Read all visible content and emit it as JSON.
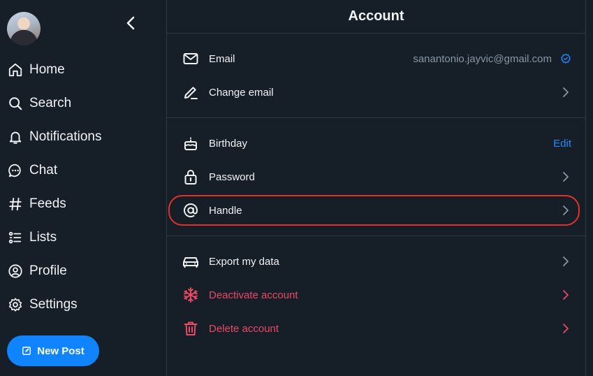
{
  "sidebar": {
    "nav": [
      {
        "label": "Home",
        "icon": "home-icon"
      },
      {
        "label": "Search",
        "icon": "search-icon"
      },
      {
        "label": "Notifications",
        "icon": "bell-icon"
      },
      {
        "label": "Chat",
        "icon": "chat-bubble-icon"
      },
      {
        "label": "Feeds",
        "icon": "hashtag-icon"
      },
      {
        "label": "Lists",
        "icon": "list-icon"
      },
      {
        "label": "Profile",
        "icon": "user-circle-icon"
      },
      {
        "label": "Settings",
        "icon": "gear-icon"
      }
    ],
    "new_post_label": "New Post"
  },
  "header": {
    "title": "Account"
  },
  "groups": [
    {
      "rows": [
        {
          "label": "Email",
          "value": "sanantonio.jayvic@gmail.com",
          "icon": "envelope-icon",
          "trailing": "verified-badge-icon"
        },
        {
          "label": "Change email",
          "icon": "pencil-icon",
          "trailing": "chevron-right-icon"
        }
      ]
    },
    {
      "rows": [
        {
          "label": "Birthday",
          "icon": "cake-icon",
          "action": "Edit"
        },
        {
          "label": "Password",
          "icon": "lock-icon",
          "trailing": "chevron-right-icon"
        },
        {
          "label": "Handle",
          "icon": "at-sign-icon",
          "trailing": "chevron-right-icon",
          "highlighted": true
        }
      ]
    },
    {
      "rows": [
        {
          "label": "Export my data",
          "icon": "car-icon",
          "trailing": "chevron-right-icon"
        },
        {
          "label": "Deactivate account",
          "icon": "snowflake-icon",
          "trailing": "chevron-right-icon",
          "danger": true
        },
        {
          "label": "Delete account",
          "icon": "trash-icon",
          "trailing": "chevron-right-icon",
          "danger": true
        }
      ]
    }
  ],
  "colors": {
    "background": "#161e27",
    "divider": "#2e3945",
    "accent": "#1083fe",
    "link": "#208bfe",
    "danger": "#ec4868",
    "highlight_ring": "#e0322b",
    "muted_text": "#8796a8"
  }
}
